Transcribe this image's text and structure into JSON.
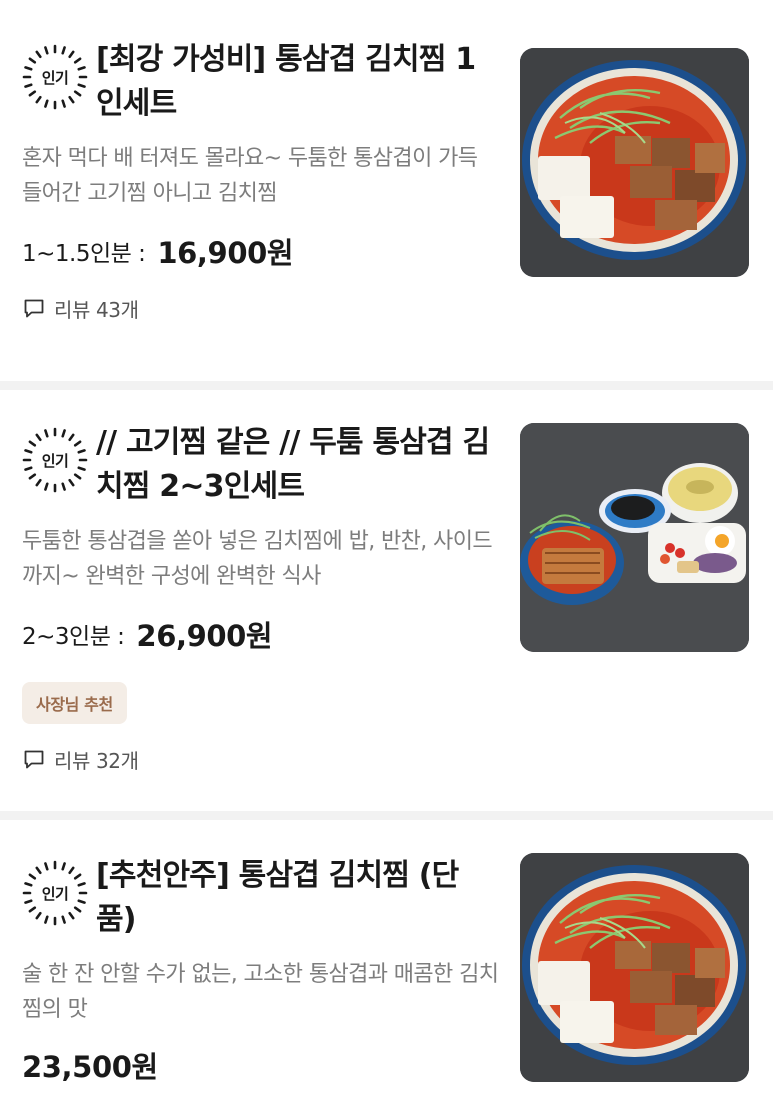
{
  "menu_items": [
    {
      "badge": "인기",
      "title": "[최강 가성비] 통삼겹 김치찜 1인세트",
      "description": "혼자 먹다 배 터져도 몰라요~ 두툼한 통삼겹이 가득 들어간 고기찜 아니고 김치찜",
      "price_label": "1~1.5인분 :",
      "price": "16,900원",
      "tag": "",
      "review": "리뷰 43개",
      "image": "kimchi-jjim-bowl-photo"
    },
    {
      "badge": "인기",
      "title": "// 고기찜 같은 // 두툼 통삼겹 김치찜 2~3인세트",
      "description": "두툼한 통삼겹을 쏟아 넣은 김치찜에 밥, 반찬, 사이드까지~ 완벽한 구성에 완벽한 식사",
      "price_label": "2~3인분 :",
      "price": "26,900원",
      "tag": "사장님 추천",
      "review": "리뷰 32개",
      "image": "kimchi-jjim-set-photo"
    },
    {
      "badge": "인기",
      "title": "[추천안주] 통삼겹 김치찜 (단품)",
      "description": "술 한 잔 안할 수가 없는, 고소한 통삼겹과 매콤한 김치찜의 맛",
      "price_label": "",
      "price": "23,500원",
      "tag": "",
      "review": "",
      "image": "kimchi-jjim-bowl-photo"
    }
  ],
  "colors": {
    "text": "#1a1a1a",
    "muted": "#7d7d7d",
    "tag_bg": "#f4ede6",
    "tag_text": "#9a6b4c",
    "divider": "#f2f2f2"
  },
  "icons": {
    "review": "speech-bubble-icon",
    "badge": "sunburst-badge-icon"
  }
}
